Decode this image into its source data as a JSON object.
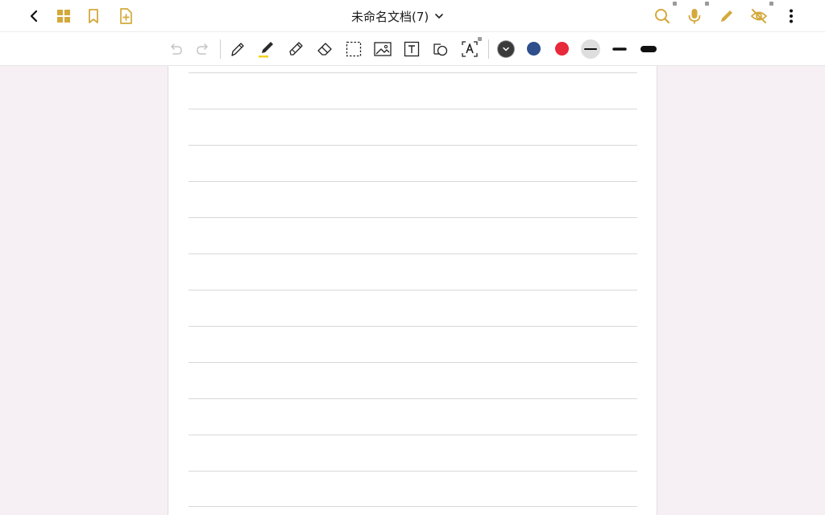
{
  "header": {
    "title": "未命名文档(7)",
    "accent_color": "#d4a93c",
    "icons": {
      "back": "chevron-left-icon",
      "grid": "grid-icon",
      "bookmark": "bookmark-icon",
      "add_page": "add-page-icon",
      "title_dropdown": "chevron-down-icon",
      "search": "search-icon",
      "microphone": "microphone-icon",
      "pencil": "pencil-icon",
      "hide": "eye-off-icon",
      "more": "more-vertical-icon"
    }
  },
  "toolbar": {
    "tools": [
      "undo-icon",
      "redo-icon",
      "pen-icon",
      "marker-icon",
      "highlighter-icon",
      "eraser-icon",
      "lasso-select-icon",
      "image-icon",
      "text-box-icon",
      "shape-icon",
      "ocr-text-icon"
    ],
    "colors": [
      "#3a3a3a",
      "#2e4e8c",
      "#e8283b"
    ],
    "selected_color": "#3a3a3a",
    "stroke_widths": [
      "thin",
      "medium",
      "thick"
    ],
    "selected_stroke": "thin"
  },
  "page": {
    "paper_style": "lined",
    "line_count": 13
  }
}
